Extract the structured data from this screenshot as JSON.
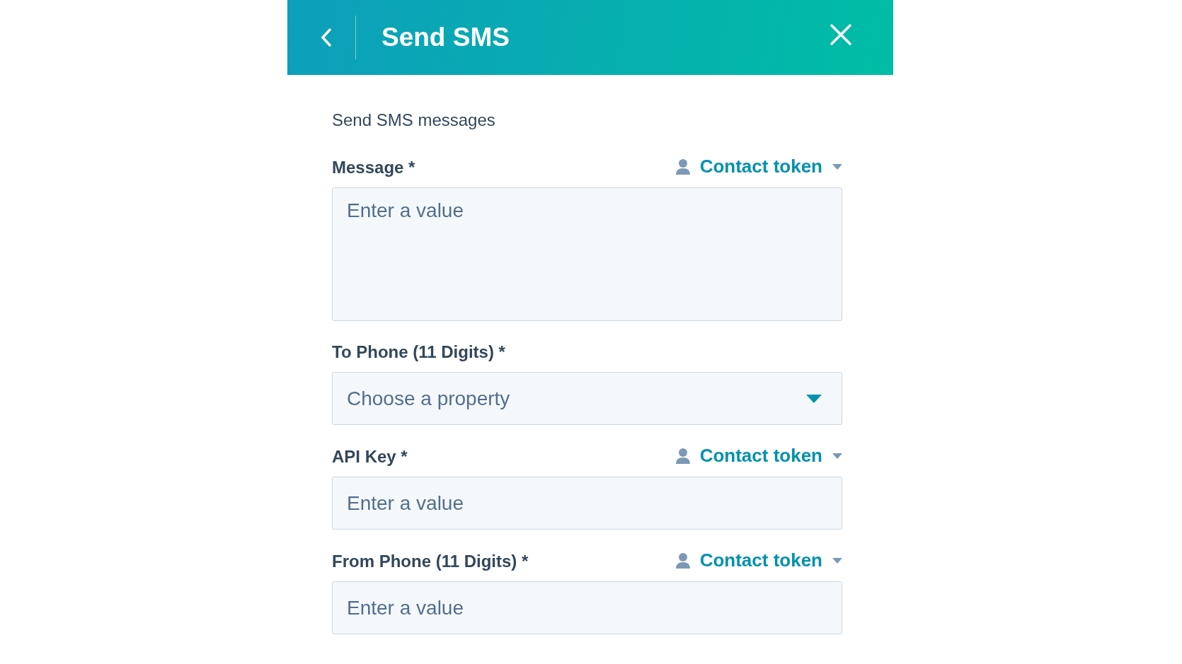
{
  "header": {
    "title": "Send SMS"
  },
  "description": "Send SMS messages",
  "fields": [
    {
      "kind": "textarea",
      "label": "Message *",
      "token": "Contact token",
      "placeholder": "Enter a value"
    },
    {
      "kind": "select",
      "label": "To Phone (11 Digits) *",
      "placeholder": "Choose a property"
    },
    {
      "kind": "input",
      "label": "API Key *",
      "token": "Contact token",
      "placeholder": "Enter a value"
    },
    {
      "kind": "input",
      "label": "From Phone (11 Digits) *",
      "token": "Contact token",
      "placeholder": "Enter a value"
    }
  ]
}
